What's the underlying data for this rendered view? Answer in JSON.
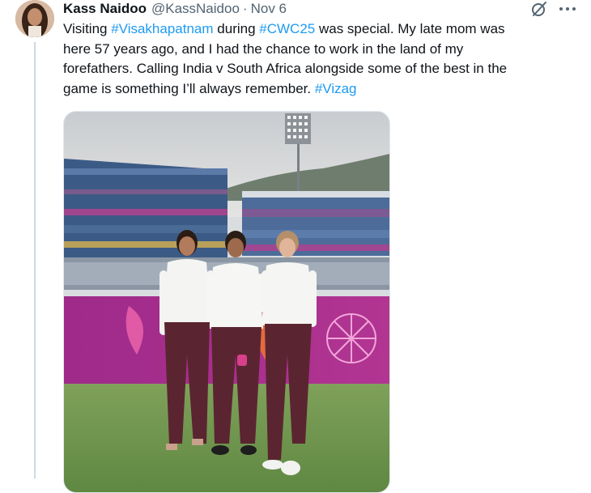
{
  "post": {
    "author_name": "Kass Naidoo",
    "handle": "@KassNaidoo",
    "separator": "·",
    "date": "Nov 6",
    "text_lines": [
      [
        {
          "t": "Visiting ",
          "tag": false
        },
        {
          "t": "#Visakhapatnam",
          "tag": true
        },
        {
          "t": " during ",
          "tag": false
        },
        {
          "t": "#CWC25",
          "tag": true
        },
        {
          "t": " was special. My late mom was",
          "tag": false
        }
      ],
      [
        {
          "t": "here 57 years ago, and I had the chance to work in the land of my",
          "tag": false
        }
      ],
      [
        {
          "t": "forefathers. Calling India v South Africa alongside some of the best in the",
          "tag": false
        }
      ],
      [
        {
          "t": "game is something I’ll always remember. ",
          "tag": false
        },
        {
          "t": "#Vizag",
          "tag": true
        }
      ]
    ]
  },
  "icons": {
    "avatar": "avatar-photo",
    "grok": "grok-icon",
    "more": "more-options-icon"
  },
  "colors": {
    "text": "#0f1419",
    "secondary": "#536471",
    "link": "#1d9bf0",
    "thread_line": "#cfd9de"
  }
}
